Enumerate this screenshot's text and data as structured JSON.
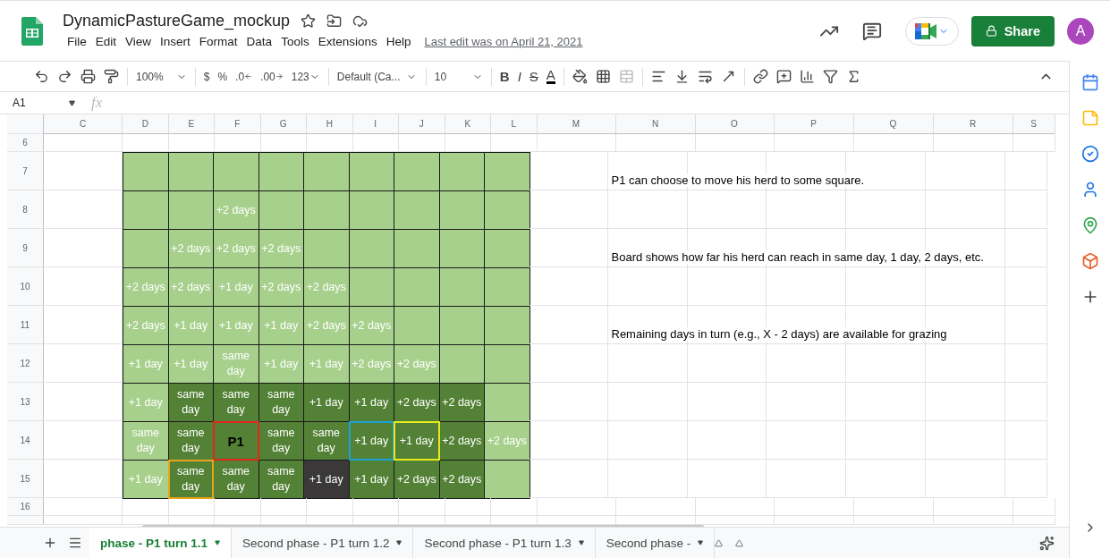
{
  "document": {
    "title": "DynamicPastureGame_mockup",
    "menus": [
      "File",
      "Edit",
      "View",
      "Insert",
      "Format",
      "Data",
      "Tools",
      "Extensions",
      "Help"
    ],
    "last_edit": "Last edit was on April 21, 2021"
  },
  "header": {
    "share": "Share",
    "avatar": "A"
  },
  "toolbar": {
    "zoom": "100%",
    "currency": "$",
    "percent": "%",
    "decimal_less": ".0",
    "decimal_more": ".00",
    "number_format": "123",
    "font": "Default (Ca...",
    "font_size": "10",
    "bold": "B",
    "italic": "I",
    "strike": "S",
    "text_color": "A"
  },
  "formula_bar": {
    "cell_ref": "A1",
    "fx": "fx"
  },
  "columns": [
    "C",
    "D",
    "E",
    "F",
    "G",
    "H",
    "I",
    "J",
    "K",
    "L",
    "M",
    "N",
    "O",
    "P",
    "Q",
    "R",
    "S"
  ],
  "rows": [
    {
      "number": "6",
      "board": []
    },
    {
      "number": "7",
      "note": "P1 can choose to move his herd to some square.",
      "board": [
        {
          "kind": "light"
        },
        {
          "kind": "light"
        },
        {
          "kind": "light"
        },
        {
          "kind": "light"
        },
        {
          "kind": "light"
        },
        {
          "kind": "light"
        },
        {
          "kind": "light"
        },
        {
          "kind": "light"
        },
        {
          "kind": "light"
        }
      ]
    },
    {
      "number": "8",
      "board": [
        {
          "kind": "light"
        },
        {
          "kind": "light"
        },
        {
          "kind": "light",
          "text": "+2 days"
        },
        {
          "kind": "light"
        },
        {
          "kind": "light"
        },
        {
          "kind": "light"
        },
        {
          "kind": "light"
        },
        {
          "kind": "light"
        },
        {
          "kind": "light"
        }
      ]
    },
    {
      "number": "9",
      "note": "Board shows how far his herd can reach in same day, 1 day, 2 days, etc.",
      "board": [
        {
          "kind": "light"
        },
        {
          "kind": "light",
          "text": "+2 days"
        },
        {
          "kind": "light",
          "text": "+2 days"
        },
        {
          "kind": "light",
          "text": "+2 days"
        },
        {
          "kind": "light"
        },
        {
          "kind": "light"
        },
        {
          "kind": "light"
        },
        {
          "kind": "light"
        },
        {
          "kind": "light"
        }
      ]
    },
    {
      "number": "10",
      "board": [
        {
          "kind": "light",
          "text": "+2 days"
        },
        {
          "kind": "light",
          "text": "+2 days"
        },
        {
          "kind": "light",
          "text": "+1 day"
        },
        {
          "kind": "light",
          "text": "+2 days"
        },
        {
          "kind": "light",
          "text": "+2 days"
        },
        {
          "kind": "light"
        },
        {
          "kind": "light"
        },
        {
          "kind": "light"
        },
        {
          "kind": "light"
        }
      ]
    },
    {
      "number": "11",
      "note": "Remaining days in turn (e.g., X - 2 days) are available for grazing",
      "board": [
        {
          "kind": "light",
          "text": "+2 days"
        },
        {
          "kind": "light",
          "text": "+1 day"
        },
        {
          "kind": "light",
          "text": "+1 day"
        },
        {
          "kind": "light",
          "text": "+1 day"
        },
        {
          "kind": "light",
          "text": "+2 days"
        },
        {
          "kind": "light",
          "text": "+2 days"
        },
        {
          "kind": "light"
        },
        {
          "kind": "light"
        },
        {
          "kind": "light"
        }
      ]
    },
    {
      "number": "12",
      "board": [
        {
          "kind": "light",
          "text": "+1 day"
        },
        {
          "kind": "light",
          "text": "+1 day"
        },
        {
          "kind": "light",
          "text": "same day"
        },
        {
          "kind": "light",
          "text": "+1 day"
        },
        {
          "kind": "light",
          "text": "+1 day"
        },
        {
          "kind": "light",
          "text": "+2 days"
        },
        {
          "kind": "light",
          "text": "+2 days"
        },
        {
          "kind": "light"
        },
        {
          "kind": "light"
        }
      ]
    },
    {
      "number": "13",
      "board": [
        {
          "kind": "light",
          "text": "+1 day"
        },
        {
          "kind": "dark",
          "text": "same day"
        },
        {
          "kind": "dark",
          "text": "same day"
        },
        {
          "kind": "dark",
          "text": "same day"
        },
        {
          "kind": "dark",
          "text": "+1 day"
        },
        {
          "kind": "dark",
          "text": "+1 day"
        },
        {
          "kind": "dark",
          "text": "+2 days"
        },
        {
          "kind": "dark",
          "text": "+2 days"
        },
        {
          "kind": "light"
        }
      ]
    },
    {
      "number": "14",
      "board": [
        {
          "kind": "light",
          "text": "same day"
        },
        {
          "kind": "dark",
          "text": "same day"
        },
        {
          "kind": "dark",
          "text": "P1",
          "player": true,
          "color": "#e0271b"
        },
        {
          "kind": "dark",
          "text": "same day"
        },
        {
          "kind": "dark",
          "text": "same day"
        },
        {
          "kind": "dark",
          "text": "+1 day",
          "color": "#1aa1d6"
        },
        {
          "kind": "dark",
          "text": "+1 day",
          "color": "#e8e81c"
        },
        {
          "kind": "dark",
          "text": "+2 days"
        },
        {
          "kind": "light",
          "text": "+2 days"
        }
      ]
    },
    {
      "number": "15",
      "board": [
        {
          "kind": "light",
          "text": "+1 day"
        },
        {
          "kind": "dark",
          "text": "same day",
          "color": "#e8a31c"
        },
        {
          "kind": "dark",
          "text": "same day"
        },
        {
          "kind": "dark",
          "text": "same day"
        },
        {
          "kind": "black",
          "text": "+1 day"
        },
        {
          "kind": "dark",
          "text": "+1 day"
        },
        {
          "kind": "dark",
          "text": "+2 days"
        },
        {
          "kind": "dark",
          "text": "+2 days"
        },
        {
          "kind": "light"
        }
      ]
    },
    {
      "number": "16",
      "board": []
    }
  ],
  "sheet_tabs": [
    {
      "label": "phase - P1 turn 1.1",
      "selected": true
    },
    {
      "label": "Second phase - P1 turn 1.2",
      "selected": false
    },
    {
      "label": "Second phase - P1 turn 1.3",
      "selected": false
    },
    {
      "label": "Second phase -",
      "selected": false
    }
  ]
}
